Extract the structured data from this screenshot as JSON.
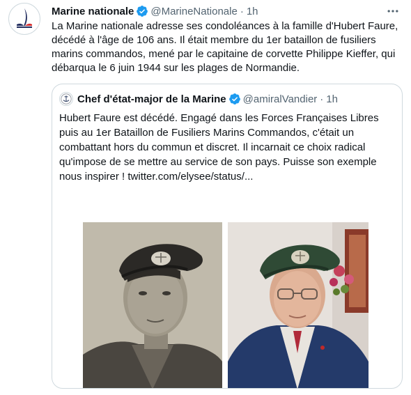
{
  "tweet": {
    "author_name": "Marine nationale",
    "author_handle": "@MarineNationale",
    "separator": "·",
    "time": "1h",
    "more_icon": "more-horizontal-icon",
    "text": "La Marine nationale adresse ses condoléances à la famille d'Hubert Faure, décédé à l'âge de 106 ans. Il était membre du 1er bataillon de fusiliers marins commandos, mené par le capitaine de corvette Philippe Kieffer, qui débarqua le 6 juin 1944 sur les plages de Normandie."
  },
  "quoted": {
    "author_name": "Chef d'état-major de la Marine",
    "author_handle": "@amiralVandier",
    "separator": "·",
    "time": "1h",
    "text": "Hubert Faure est décédé. Engagé dans les Forces Françaises Libres puis au 1er Bataillon de Fusiliers Marins Commandos, c'était un combattant hors du commun et discret. Il incarnait ce choix radical qu'impose de se mettre au service de son pays. Puisse son exemple nous inspirer ! twitter.com/elysee/status/..."
  },
  "colors": {
    "verified": "#1d9bf0",
    "text": "#0f1419",
    "secondary": "#536471",
    "border": "#cfd9de",
    "beret": "#2f4a35"
  }
}
